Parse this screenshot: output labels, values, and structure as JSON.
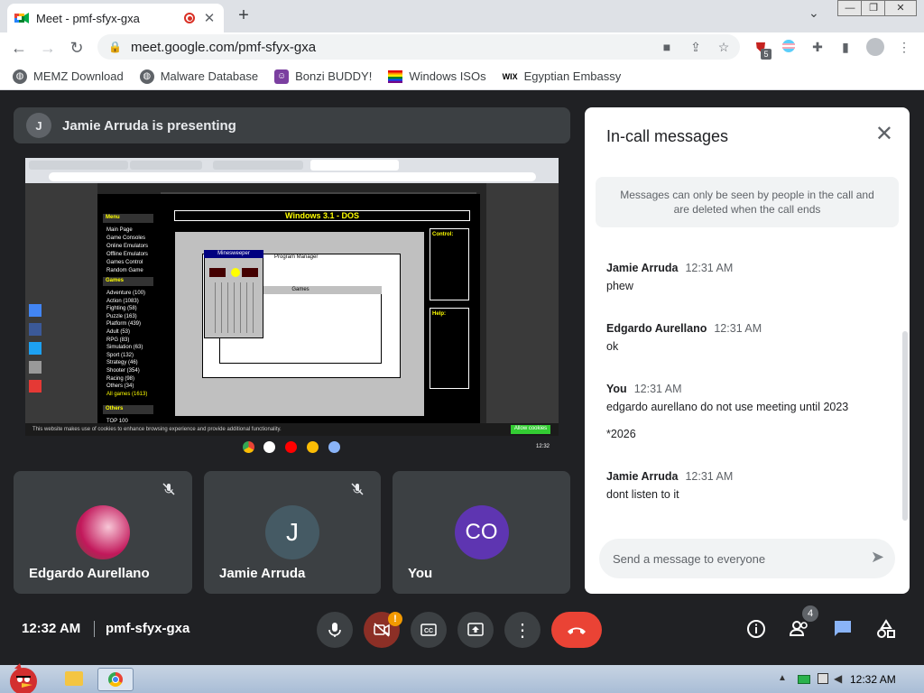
{
  "browser": {
    "tab_title": "Meet - pmf-sfyx-gxa",
    "url": "meet.google.com/pmf-sfyx-gxa",
    "extension_badge": "5",
    "bookmarks": [
      {
        "label": "MEMZ Download",
        "icon": "globe-icon"
      },
      {
        "label": "Malware Database",
        "icon": "globe-icon"
      },
      {
        "label": "Bonzi BUDDY!",
        "icon": "bonzi-icon"
      },
      {
        "label": "Windows ISOs",
        "icon": "rainbow-flag-icon"
      },
      {
        "label": "Egyptian Embassy",
        "icon": "wix-icon"
      }
    ],
    "wix_label": "WIX"
  },
  "meet": {
    "presenter_initial": "J",
    "presenter_text": "Jamie Arruda is presenting",
    "shared_screen": {
      "page_title": "Windows 3.1 - DOS",
      "menu_title": "Menu",
      "menu_items": [
        "Main Page",
        "Game Consoles",
        "Online Emulators",
        "Offline Emulators",
        "Games Control",
        "Random Game"
      ],
      "games_title": "Games",
      "games_items": [
        "Adventure (100)",
        "Action (1083)",
        "Fighting (58)",
        "Puzzle (163)",
        "Platform (439)",
        "Adult (53)",
        "RPG (83)",
        "Simulation (63)",
        "Sport (132)",
        "Strategy (46)",
        "Shooter (354)",
        "Racing (98)",
        "Others (34)",
        "All games (1613)"
      ],
      "others_title": "Others",
      "others_item": "TOP 100",
      "control_title": "Control:",
      "help_title": "Help:",
      "window_minesweeper": "Minesweeper",
      "window_program_manager": "Program Manager",
      "window_games": "Games",
      "cookie_text": "This website makes use of cookies to enhance browsing experience and provide additional functionality.",
      "cookie_button": "Allow cookies",
      "taskbar_time": "12:32"
    },
    "participants": [
      {
        "name": "Edgardo Aurellano",
        "initials": "",
        "muted": true
      },
      {
        "name": "Jamie Arruda",
        "initials": "J",
        "muted": true
      },
      {
        "name": "You",
        "initials": "CO",
        "muted": false
      }
    ],
    "clock": "12:32 AM",
    "meeting_code": "pmf-sfyx-gxa",
    "people_count": "4",
    "camera_warning": "!"
  },
  "chat": {
    "title": "In-call messages",
    "notice": "Messages can only be seen by people in the call and are deleted when the call ends",
    "messages": [
      {
        "sender": "Jamie Arruda",
        "time": "12:31 AM",
        "texts": [
          "phew"
        ]
      },
      {
        "sender": "Edgardo Aurellano",
        "time": "12:31 AM",
        "texts": [
          "ok"
        ]
      },
      {
        "sender": "You",
        "time": "12:31 AM",
        "texts": [
          "edgardo aurellano do not use meeting until 2023",
          "*2026"
        ]
      },
      {
        "sender": "Jamie Arruda",
        "time": "12:31 AM",
        "texts": [
          "dont listen to it"
        ]
      }
    ],
    "composer_placeholder": "Send a message to everyone"
  },
  "windows": {
    "tray_time": "12:32 AM"
  },
  "colors": {
    "meet_bg": "#202124",
    "tile_bg": "#3c4043",
    "hangup": "#ea4335",
    "you_avatar": "#5e35b1",
    "accent_blue": "#1a73e8"
  }
}
